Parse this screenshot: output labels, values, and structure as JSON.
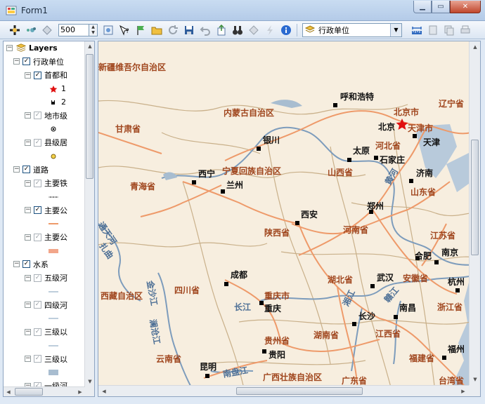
{
  "window": {
    "title": "Form1"
  },
  "toolbar": {
    "scale_value": "500",
    "layer_select": "行政单位"
  },
  "toc": {
    "items": [
      {
        "label": "Layers",
        "level": 0,
        "expander": "−",
        "check": "none",
        "bold": true,
        "icon": "layers-icon"
      },
      {
        "label": "行政单位",
        "level": 1,
        "expander": "−",
        "check": "checked"
      },
      {
        "label": "首都和",
        "level": 2,
        "expander": "−",
        "check": "checked"
      },
      {
        "label": "1",
        "level": 3,
        "symbol": "red-star"
      },
      {
        "label": "2",
        "level": 3,
        "symbol": "black-square"
      },
      {
        "label": "地市级",
        "level": 2,
        "expander": "−",
        "check": "grey"
      },
      {
        "label": "",
        "level": 3,
        "symbol": "dot-circle"
      },
      {
        "label": "县级居",
        "level": 2,
        "expander": "−",
        "check": "grey"
      },
      {
        "label": "",
        "level": 3,
        "symbol": "yellow-circle"
      },
      {
        "label": "道路",
        "level": 1,
        "expander": "−",
        "check": "checked"
      },
      {
        "label": "主要铁",
        "level": 2,
        "expander": "−",
        "check": "grey"
      },
      {
        "label": "",
        "level": 3,
        "symbol": "rail-line"
      },
      {
        "label": "主要公",
        "level": 2,
        "expander": "−",
        "check": "checked"
      },
      {
        "label": "",
        "level": 3,
        "symbol": "orange-line"
      },
      {
        "label": "主要公",
        "level": 2,
        "expander": "−",
        "check": "grey"
      },
      {
        "label": "",
        "level": 3,
        "symbol": "salmon-rect"
      },
      {
        "label": "水系",
        "level": 1,
        "expander": "−",
        "check": "checked"
      },
      {
        "label": "五级河",
        "level": 2,
        "expander": "−",
        "check": "grey"
      },
      {
        "label": "",
        "level": 3,
        "symbol": "blue-line"
      },
      {
        "label": "四级河",
        "level": 2,
        "expander": "−",
        "check": "grey"
      },
      {
        "label": "",
        "level": 3,
        "symbol": "blue-line"
      },
      {
        "label": "三级以",
        "level": 2,
        "expander": "−",
        "check": "grey"
      },
      {
        "label": "",
        "level": 3,
        "symbol": "blue-line"
      },
      {
        "label": "三级以",
        "level": 2,
        "expander": "−",
        "check": "grey"
      },
      {
        "label": "",
        "level": 3,
        "symbol": "blue-rect"
      },
      {
        "label": "一级河",
        "level": 2,
        "expander": "−",
        "check": "grey"
      }
    ]
  },
  "map": {
    "colors": {
      "land": "#f7eedf",
      "water": "#a8bdd0",
      "road": "#ee9a6a",
      "border": "#c9b08a",
      "province_label": "#a0461e"
    },
    "provinces": [
      {
        "text": "新疆维吾尔自治区"
      },
      {
        "text": "内蒙古自治区"
      },
      {
        "text": "甘肃省"
      },
      {
        "text": "宁夏回族自治区"
      },
      {
        "text": "青海省"
      },
      {
        "text": "山西省"
      },
      {
        "text": "河北省"
      },
      {
        "text": "辽宁省"
      },
      {
        "text": "山东省"
      },
      {
        "text": "陕西省"
      },
      {
        "text": "河南省"
      },
      {
        "text": "江苏省"
      },
      {
        "text": "四川省"
      },
      {
        "text": "西藏自治区"
      },
      {
        "text": "湖北省"
      },
      {
        "text": "安徽省"
      },
      {
        "text": "浙江省"
      },
      {
        "text": "重庆市"
      },
      {
        "text": "湖南省"
      },
      {
        "text": "江西省"
      },
      {
        "text": "贵州省"
      },
      {
        "text": "云南省"
      },
      {
        "text": "福建省"
      },
      {
        "text": "广西壮族自治区"
      },
      {
        "text": "广东省"
      },
      {
        "text": "台湾省"
      },
      {
        "text": "北京市"
      },
      {
        "text": "天津市"
      }
    ],
    "cities": [
      {
        "text": "呼和浩特"
      },
      {
        "text": "北京"
      },
      {
        "text": "天津"
      },
      {
        "text": "银川"
      },
      {
        "text": "太原"
      },
      {
        "text": "石家庄"
      },
      {
        "text": "西宁"
      },
      {
        "text": "兰州"
      },
      {
        "text": "济南"
      },
      {
        "text": "郑州"
      },
      {
        "text": "西安"
      },
      {
        "text": "合肥"
      },
      {
        "text": "南京"
      },
      {
        "text": "成都"
      },
      {
        "text": "武汉"
      },
      {
        "text": "杭州"
      },
      {
        "text": "重庆"
      },
      {
        "text": "长沙"
      },
      {
        "text": "南昌"
      },
      {
        "text": "贵阳"
      },
      {
        "text": "昆明"
      },
      {
        "text": "福州"
      }
    ],
    "rivers": [
      {
        "text": "黄河"
      },
      {
        "text": "通天河"
      },
      {
        "text": "扎曲"
      },
      {
        "text": "金沙江"
      },
      {
        "text": "澜沧江"
      },
      {
        "text": "长江"
      },
      {
        "text": "湘江"
      },
      {
        "text": "赣江"
      },
      {
        "text": "南盘江"
      }
    ]
  }
}
